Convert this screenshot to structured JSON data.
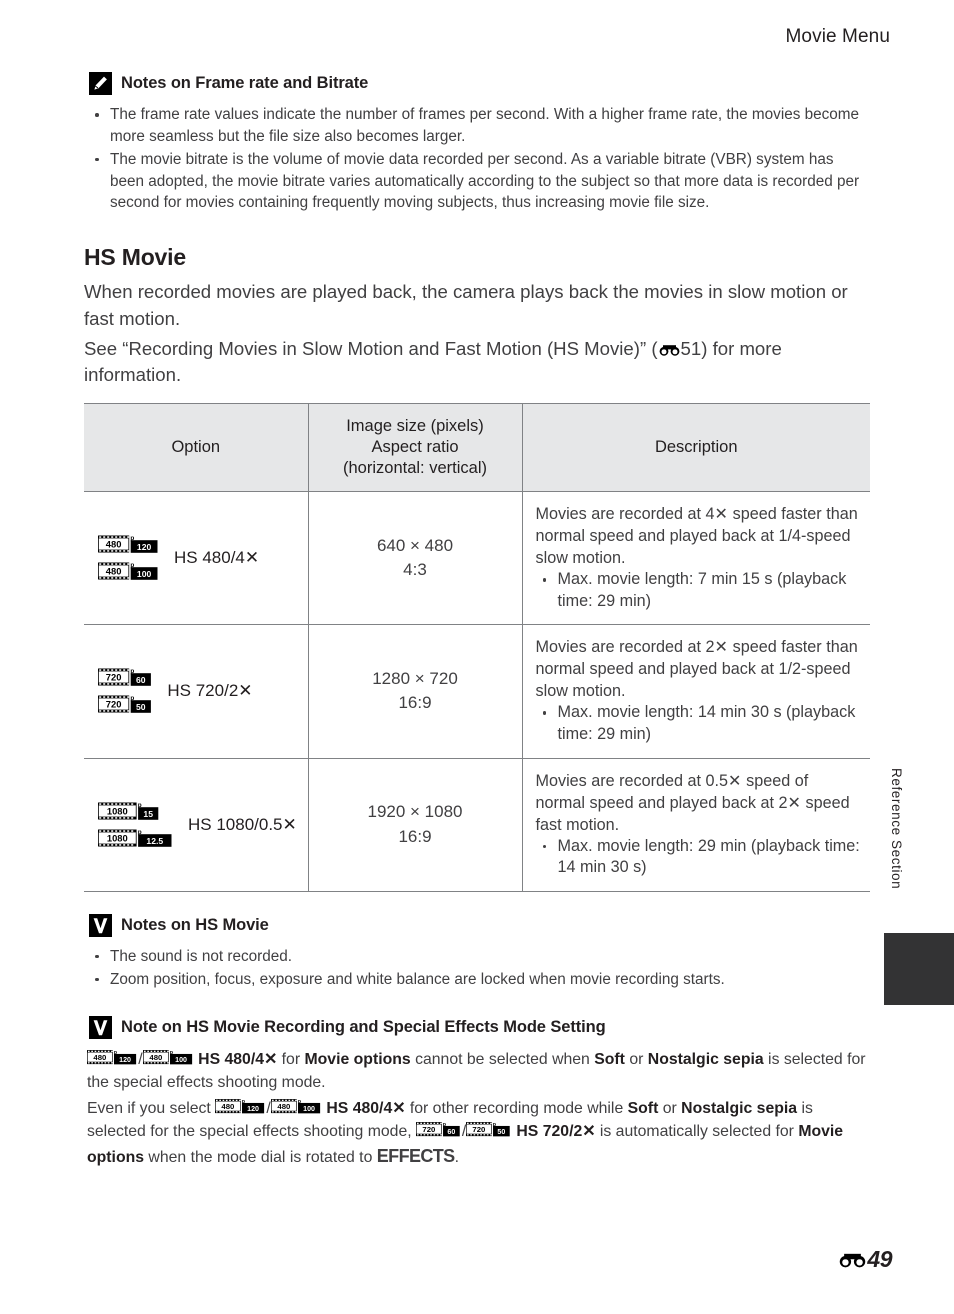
{
  "header": {
    "title": "Movie Menu"
  },
  "side_tab": {
    "label": "Reference Section"
  },
  "notes_frame_rate": {
    "icon": "pencil-icon",
    "title": "Notes on Frame rate and Bitrate",
    "bullets": [
      "The frame rate values indicate the number of frames per second. With a higher frame rate, the movies become more seamless but the file size also becomes larger.",
      "The movie bitrate is the volume of movie data recorded per second. As a variable bitrate (VBR) system has been adopted, the movie bitrate varies automatically according to the subject so that more data is recorded per second for movies containing frequently moving subjects, thus increasing movie file size."
    ]
  },
  "hs_movie": {
    "title": "HS Movie",
    "para1": "When recorded movies are played back, the camera plays back the movies in slow motion or fast motion.",
    "para2_before": "See “Recording Movies in Slow Motion and Fast Motion (HS Movie)” (",
    "para2_ref": "51",
    "para2_after": ") for more information."
  },
  "table": {
    "headers": {
      "option": "Option",
      "image_size_line1": "Image size (pixels)",
      "image_size_line2": "Aspect ratio",
      "image_size_line3": "(horizontal: vertical)",
      "description": "Description"
    },
    "rows": [
      {
        "icons": [
          {
            "name": "movie-icon-480p-120",
            "res": "480",
            "sup": "p",
            "rate": "120"
          },
          {
            "name": "movie-icon-480p-100",
            "res": "480",
            "sup": "p",
            "rate": "100"
          }
        ],
        "option": "HS 480/4✕",
        "size_line1": "640 × 480",
        "size_line2": "4:3",
        "desc_para": "Movies are recorded at 4✕ speed faster than normal speed and played back at 1/4-speed slow motion.",
        "desc_bullets": [
          "Max. movie length: 7 min 15 s (playback time: 29 min)"
        ]
      },
      {
        "icons": [
          {
            "name": "movie-icon-720p-60",
            "res": "720",
            "sup": "p",
            "rate": "60"
          },
          {
            "name": "movie-icon-720p-50",
            "res": "720",
            "sup": "p",
            "rate": "50"
          }
        ],
        "option": "HS 720/2✕",
        "size_line1": "1280 × 720",
        "size_line2": "16:9",
        "desc_para": "Movies are recorded at 2✕ speed faster than normal speed and played back at 1/2-speed slow motion.",
        "desc_bullets": [
          "Max. movie length: 14 min 30 s (playback time: 29 min)"
        ]
      },
      {
        "icons": [
          {
            "name": "movie-icon-1080p-15",
            "res": "1080",
            "sup": "p",
            "rate": "15"
          },
          {
            "name": "movie-icon-1080p-125",
            "res": "1080",
            "sup": "p",
            "rate": "12.5"
          }
        ],
        "option": "HS 1080/0.5✕",
        "size_line1": "1920 × 1080",
        "size_line2": "16:9",
        "desc_para": "Movies are recorded at 0.5✕ speed of normal speed and played back at 2✕ speed fast motion.",
        "desc_bullets": [
          "Max. movie length: 29 min (playback time: 14 min 30 s)"
        ]
      }
    ]
  },
  "notes_hs_movie": {
    "icon": "caution-v-icon",
    "title": "Notes on HS Movie",
    "bullets": [
      "The sound is not recorded.",
      "Zoom position, focus, exposure and white balance are locked when movie recording starts."
    ]
  },
  "note_special_effects": {
    "icon": "caution-v-icon",
    "title": "Note on HS Movie Recording and Special Effects Mode Setting",
    "para1": {
      "icon_a": {
        "res": "480",
        "sup": "p",
        "rate": "120"
      },
      "sep": "/",
      "icon_b": {
        "res": "480",
        "sup": "p",
        "rate": "100"
      },
      "t1": " ",
      "b1": "HS 480/4✕",
      "t2": " for ",
      "b2": "Movie options",
      "t3": " cannot be selected when ",
      "b3": "Soft",
      "t4": " or ",
      "b4": "Nostalgic sepia",
      "t5": " is selected for the special effects shooting mode."
    },
    "para2": {
      "t0": "Even if you select ",
      "icon_a": {
        "res": "480",
        "sup": "p",
        "rate": "120"
      },
      "sep": "/",
      "icon_b": {
        "res": "480",
        "sup": "p",
        "rate": "100"
      },
      "t1": " ",
      "b1": "HS 480/4✕",
      "t2": " for other recording mode while ",
      "b2": "Soft",
      "t3": " or ",
      "b3": "Nostalgic sepia",
      "t4": " is selected for the special effects shooting mode, ",
      "icon_c": {
        "res": "720",
        "sup": "p",
        "rate": "60"
      },
      "sep2": "/",
      "icon_d": {
        "res": "720",
        "sup": "p",
        "rate": "50"
      },
      "t5": " ",
      "b4": "HS 720/2✕",
      "t6": " is automatically selected for ",
      "b5": "Movie options",
      "t7": " when the mode dial is rotated to ",
      "effects": "EFFECTS",
      "t8": "."
    }
  },
  "footer": {
    "ref_icon": "reference-section-icon",
    "page": "49"
  },
  "colors": {
    "text": "#231f20",
    "body_text": "#414042",
    "table_border": "#808285",
    "table_header_bg": "#e6e7e8",
    "tab_block": "#333334"
  }
}
